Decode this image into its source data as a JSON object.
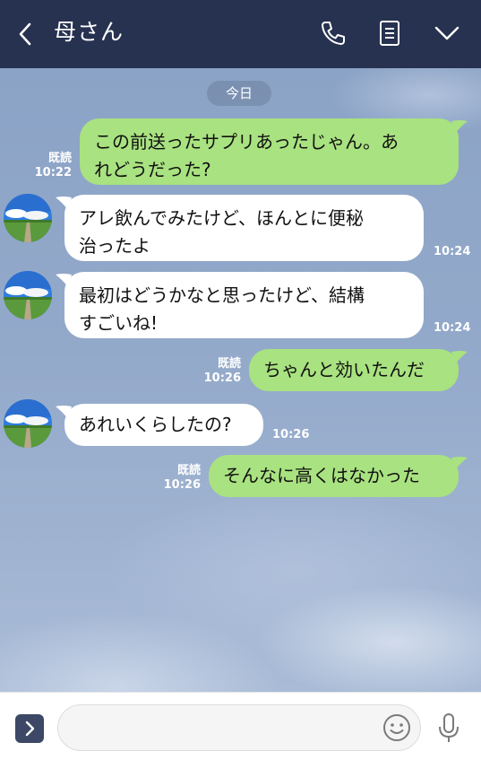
{
  "header": {
    "title": "母さん"
  },
  "chat": {
    "date_label": "今日",
    "messages": [
      {
        "side": "me",
        "lines": [
          "この前送ったサプリあったじゃん。あ",
          "れどうだった?"
        ],
        "read": "既読",
        "time": "10:22"
      },
      {
        "side": "them",
        "lines": [
          "アレ飲んでみたけど、ほんとに便秘",
          "治ったよ"
        ],
        "time": "10:24"
      },
      {
        "side": "them",
        "lines": [
          "最初はどうかなと思ったけど、結構",
          "すごいね!"
        ],
        "time": "10:24"
      },
      {
        "side": "me",
        "lines": [
          "ちゃんと効いたんだ"
        ],
        "read": "既読",
        "time": "10:26"
      },
      {
        "side": "them",
        "lines": [
          "あれいくらしたの?"
        ],
        "time": "10:26"
      },
      {
        "side": "me",
        "lines": [
          "そんなに高くはなかった"
        ],
        "read": "既読",
        "time": "10:26"
      }
    ]
  },
  "input": {
    "value": "",
    "placeholder": ""
  },
  "colors": {
    "header_bg": "#273250",
    "my_bubble": "#a9e280",
    "their_bubble": "#ffffff",
    "chat_bg": "#8fa6c8"
  },
  "icons": [
    "back-icon",
    "phone-icon",
    "notes-icon",
    "chevron-down-icon",
    "expand-icon",
    "emoji-icon",
    "mic-icon"
  ]
}
